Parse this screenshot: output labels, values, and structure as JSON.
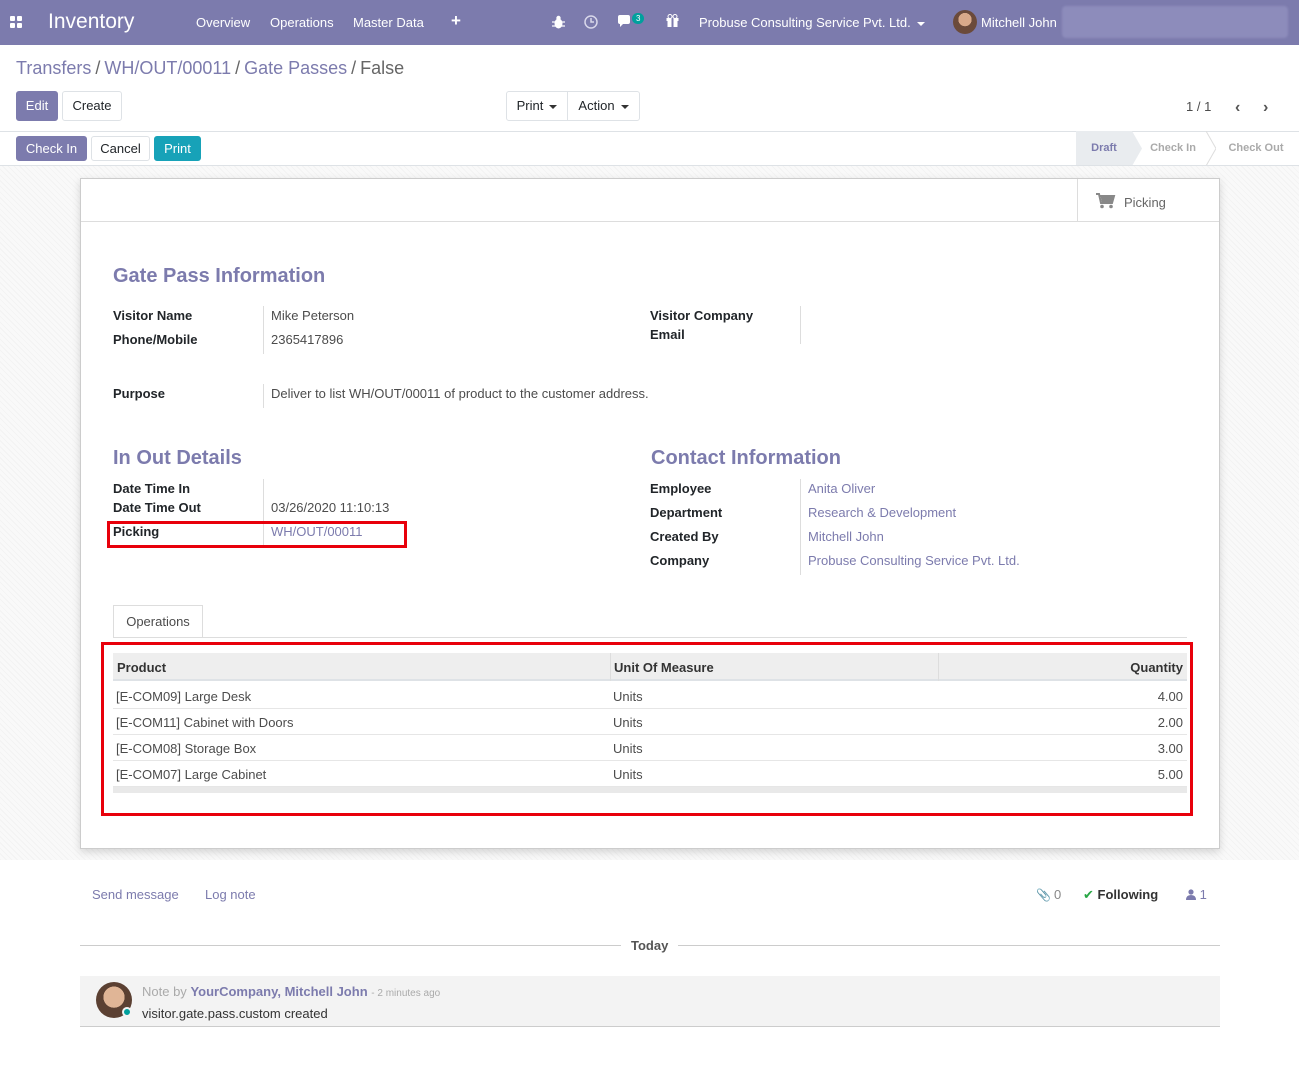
{
  "navbar": {
    "app_name": "Inventory",
    "menu": [
      "Overview",
      "Operations",
      "Master Data"
    ],
    "notification_count": "3",
    "company": "Probuse Consulting Service Pvt. Ltd.",
    "user": "Mitchell John"
  },
  "breadcrumb": {
    "items": [
      "Transfers",
      "WH/OUT/00011",
      "Gate Passes"
    ],
    "current": "False"
  },
  "control_panel": {
    "edit": "Edit",
    "create": "Create",
    "print": "Print",
    "action": "Action",
    "pager": "1 / 1"
  },
  "header_buttons": {
    "check_in": "Check In",
    "cancel": "Cancel",
    "print": "Print"
  },
  "statusbar": [
    "Draft",
    "Check In",
    "Check Out"
  ],
  "smart_button": {
    "picking": "Picking"
  },
  "gate_pass": {
    "title": "Gate Pass Information",
    "visitor_name_label": "Visitor Name",
    "visitor_name": "Mike Peterson",
    "phone_label": "Phone/Mobile",
    "phone": "2365417896",
    "visitor_company_label": "Visitor Company",
    "email_label": "Email",
    "purpose_label": "Purpose",
    "purpose": "Deliver to list WH/OUT/00011 of product to the customer address."
  },
  "in_out": {
    "title": "In Out Details",
    "date_in_label": "Date Time In",
    "date_out_label": "Date Time Out",
    "date_out": "03/26/2020 11:10:13",
    "picking_label": "Picking",
    "picking": "WH/OUT/00011"
  },
  "contact": {
    "title": "Contact Information",
    "employee_label": "Employee",
    "employee": "Anita Oliver",
    "department_label": "Department",
    "department": "Research & Development",
    "created_by_label": "Created By",
    "created_by": "Mitchell John",
    "company_label": "Company",
    "company": "Probuse Consulting Service Pvt. Ltd."
  },
  "operations": {
    "tab": "Operations",
    "columns": [
      "Product",
      "Unit Of Measure",
      "Quantity"
    ],
    "rows": [
      {
        "product": "[E-COM09] Large Desk",
        "uom": "Units",
        "qty": "4.00"
      },
      {
        "product": "[E-COM11] Cabinet with Doors",
        "uom": "Units",
        "qty": "2.00"
      },
      {
        "product": "[E-COM08] Storage Box",
        "uom": "Units",
        "qty": "3.00"
      },
      {
        "product": "[E-COM07] Large Cabinet",
        "uom": "Units",
        "qty": "5.00"
      }
    ]
  },
  "chatter": {
    "send_message": "Send message",
    "log_note": "Log note",
    "attachments": "0",
    "following": "Following",
    "followers": "1",
    "today": "Today",
    "note_prefix": "Note by",
    "note_author": "YourCompany, Mitchell John",
    "note_time": "- 2 minutes ago",
    "note_body": "visitor.gate.pass.custom created"
  },
  "colors": {
    "brand": "#7c7bad",
    "info": "#17a2b8",
    "highlight": "#e8000b",
    "online": "#00a09d"
  }
}
